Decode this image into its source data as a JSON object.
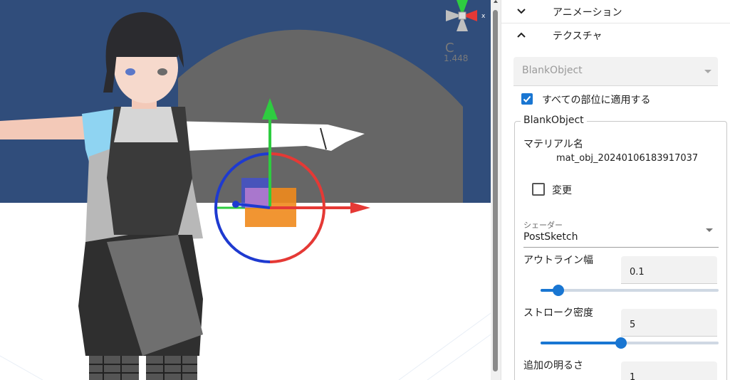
{
  "viewport": {
    "camera_label": "C",
    "zoom_label": "1.448",
    "gizmo_axis": "x",
    "colors": {
      "sky": "#304d7b",
      "floor": "#ffffff",
      "backdrop": "#666666",
      "axis_x": "#e53935",
      "axis_y": "#2ecc40",
      "axis_z": "#1e3ad0",
      "cube": "#f08a1c"
    }
  },
  "panel": {
    "animation_header": "アニメーション",
    "texture_header": "テクスチャ",
    "object_select": "BlankObject",
    "apply_all_label": "すべての部位に適用する",
    "apply_all_checked": true,
    "group_legend": "BlankObject",
    "material_name_label": "マテリアル名",
    "material_name_value": "mat_obj_20240106183917037",
    "change_label": "変更",
    "change_checked": false,
    "shader_small_label": "シェーダー",
    "shader_value": "PostSketch",
    "outline_width_label": "アウトライン幅",
    "outline_width_value": "0.1",
    "outline_width_fraction": 0.1,
    "stroke_density_label": "ストローク密度",
    "stroke_density_value": "5",
    "stroke_density_fraction": 0.45,
    "extra_brightness_label": "追加の明るさ",
    "extra_brightness_value": "1",
    "accent_color": "#1976d2"
  }
}
